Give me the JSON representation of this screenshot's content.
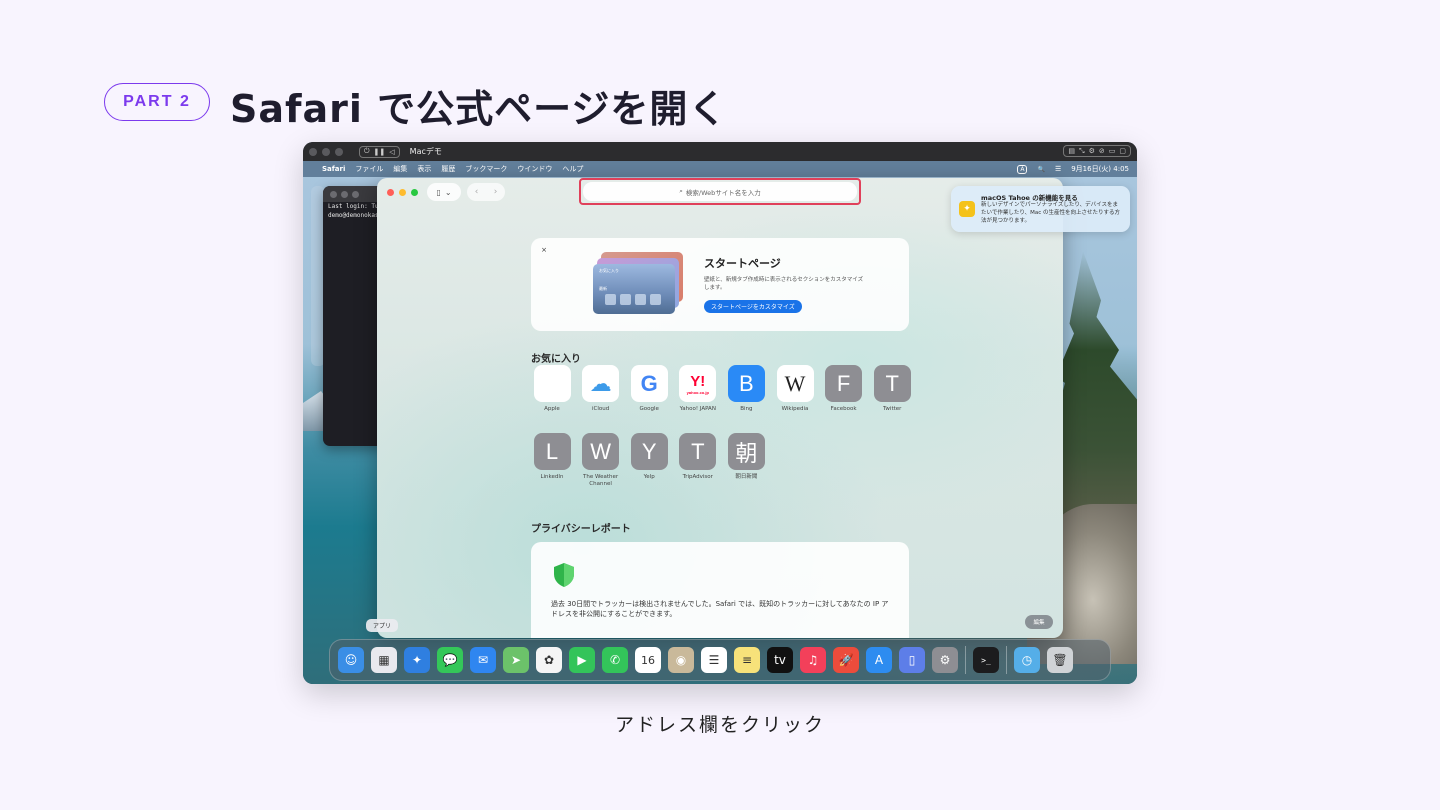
{
  "header": {
    "part_label": "PART 2",
    "title": "Safari で公式ページを開く"
  },
  "caption": "アドレス欄をクリック",
  "colors": {
    "accent": "#7c3aed",
    "highlight": "#e0405a",
    "link_blue": "#1a73e8"
  },
  "vm": {
    "title": "Macデモ",
    "controls": [
      "⏻",
      "❚❚",
      "◁"
    ],
    "right_controls": [
      "▤",
      "⤡",
      "⚙",
      "⊘",
      "▭",
      "▢"
    ]
  },
  "menubar": {
    "apple": "",
    "items": [
      "Safari",
      "ファイル",
      "編集",
      "表示",
      "履歴",
      "ブックマーク",
      "ウインドウ",
      "ヘルプ"
    ],
    "right_icons": [
      "A",
      "🔍",
      "☰"
    ],
    "datetime": "9月16日(火) 4:05"
  },
  "terminal": {
    "lines": [
      "Last login: Tu",
      "demo@demonokas"
    ]
  },
  "safari": {
    "address_placeholder": "検索/Webサイト名を入力",
    "sidebar_icon": "sidebar-icon",
    "nav_back": "‹",
    "nav_forward": "›",
    "start_page": {
      "close": "×",
      "title": "スタートページ",
      "description": "壁紙と、新規タブ作成時に表示されるセクションをカスタマイズします。",
      "button": "スタートページをカスタマイズ",
      "illustration_labels": [
        "お気に入り",
        "最新"
      ]
    },
    "favorites_heading": "お気に入り",
    "favorites": [
      {
        "name": "Apple",
        "glyph": "",
        "color": "#ffffff",
        "fg": "#333333"
      },
      {
        "name": "iCloud",
        "glyph": "☁",
        "color": "#ffffff",
        "fg": "#3d9be9"
      },
      {
        "name": "Google",
        "glyph": "G",
        "color": "#ffffff",
        "fg": "#4285f4"
      },
      {
        "name": "Yahoo! JAPAN",
        "glyph": "Y!",
        "color": "#ffffff",
        "fg": "#ff0033"
      },
      {
        "name": "Bing",
        "glyph": "B",
        "color": "#2a8af6",
        "fg": "#ffffff"
      },
      {
        "name": "Wikipedia",
        "glyph": "W",
        "color": "#ffffff",
        "fg": "#222222"
      },
      {
        "name": "Facebook",
        "glyph": "F",
        "color": "#8e8e93",
        "fg": "#ffffff"
      },
      {
        "name": "Twitter",
        "glyph": "T",
        "color": "#8e8e93",
        "fg": "#ffffff"
      },
      {
        "name": "LinkedIn",
        "glyph": "L",
        "color": "#8e8e93",
        "fg": "#ffffff"
      },
      {
        "name": "The Weather Channel",
        "glyph": "W",
        "color": "#8e8e93",
        "fg": "#ffffff"
      },
      {
        "name": "Yelp",
        "glyph": "Y",
        "color": "#8e8e93",
        "fg": "#ffffff"
      },
      {
        "name": "TripAdvisor",
        "glyph": "T",
        "color": "#8e8e93",
        "fg": "#ffffff"
      },
      {
        "name": "朝日新聞",
        "glyph": "朝",
        "color": "#8e8e93",
        "fg": "#ffffff"
      }
    ],
    "yahoo_sub": "yahoo.co.jp",
    "privacy_heading": "プライバシーレポート",
    "privacy_text": "過去 30日間でトラッカーは検出されませんでした。Safari では、既知のトラッカーに対してあなたの IP アドレスを非公開にすることができます。",
    "edit_button": "編集"
  },
  "notification": {
    "icon": "lightbulb-icon",
    "title": "macOS Tahoe の新機能を見る",
    "body": "新しいデザインでパーソナライズしたり、デバイスをまたいで作業したり、Mac の生産性を向上させたりする方法が見つかります。"
  },
  "dock": {
    "tooltip": "アプリ",
    "apps": [
      {
        "name": "finder",
        "glyph": "☺",
        "color": "#3a8ee6"
      },
      {
        "name": "launchpad",
        "glyph": "▦",
        "color": "#e9e9ee"
      },
      {
        "name": "safari",
        "glyph": "✦",
        "color": "#2f7fe0"
      },
      {
        "name": "messages",
        "glyph": "💬",
        "color": "#34c759"
      },
      {
        "name": "mail",
        "glyph": "✉",
        "color": "#2f86f0"
      },
      {
        "name": "maps",
        "glyph": "➤",
        "color": "#6cc26a"
      },
      {
        "name": "photos",
        "glyph": "✿",
        "color": "#f5f5f5"
      },
      {
        "name": "facetime",
        "glyph": "▶",
        "color": "#33c45a"
      },
      {
        "name": "phone",
        "glyph": "✆",
        "color": "#33c45a"
      },
      {
        "name": "calendar",
        "glyph": "16",
        "color": "#ffffff"
      },
      {
        "name": "contacts",
        "glyph": "◉",
        "color": "#c9b99a"
      },
      {
        "name": "reminders",
        "glyph": "☰",
        "color": "#ffffff"
      },
      {
        "name": "notes",
        "glyph": "≡",
        "color": "#f7e27a"
      },
      {
        "name": "tv",
        "glyph": "tv",
        "color": "#111111"
      },
      {
        "name": "music",
        "glyph": "♫",
        "color": "#f3405a"
      },
      {
        "name": "rocket",
        "glyph": "🚀",
        "color": "#ec4c3c"
      },
      {
        "name": "app-store",
        "glyph": "A",
        "color": "#2d8cf0"
      },
      {
        "name": "iphone-mirroring",
        "glyph": "▯",
        "color": "#5d7ee8"
      },
      {
        "name": "system-settings",
        "glyph": "⚙",
        "color": "#8e8e93"
      },
      {
        "name": "terminal",
        "glyph": ">_",
        "color": "#1c1c1e"
      },
      {
        "name": "downloads",
        "glyph": "◷",
        "color": "#55aee8"
      },
      {
        "name": "trash",
        "glyph": "🗑",
        "color": "#d0d3d6"
      }
    ]
  }
}
